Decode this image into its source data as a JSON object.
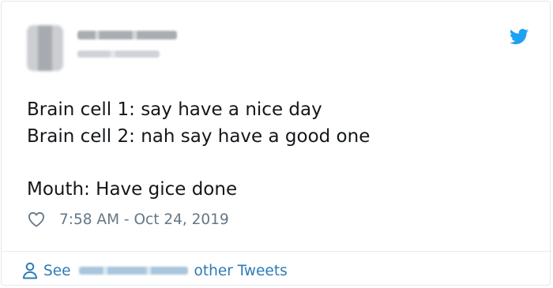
{
  "tweet": {
    "lines": [
      "Brain cell 1: say have a nice day",
      "Brain cell 2: nah say have a good one",
      "",
      "Mouth: Have gice done"
    ],
    "timestamp": "7:58 AM - Oct 24, 2019"
  },
  "footer": {
    "see_label": "See",
    "other_tweets_label": "other Tweets"
  },
  "icons": {
    "brand": "twitter-bird-icon",
    "like": "heart-icon",
    "profile": "person-icon"
  },
  "colors": {
    "text": "#14171a",
    "muted": "#657786",
    "link": "#2b7bb9",
    "brand": "#1da1f2",
    "border": "#e1e8ed"
  }
}
